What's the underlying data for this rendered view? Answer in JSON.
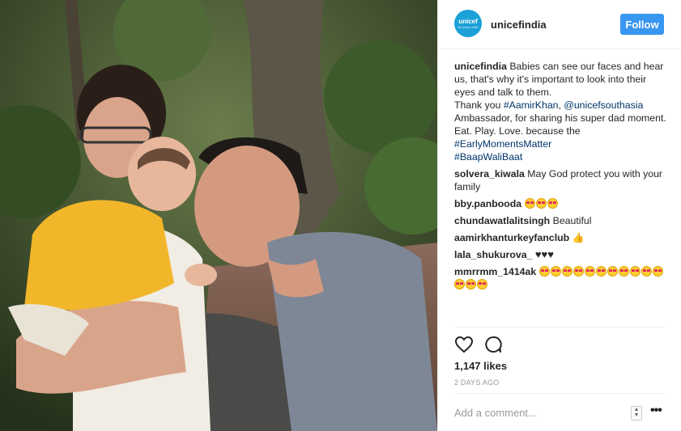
{
  "post": {
    "account": "unicefindia",
    "avatar_label": "unicef",
    "avatar_sub": "for every child",
    "follow_label": "Follow"
  },
  "caption": {
    "user": "unicefindia",
    "text1": "Babies can see our faces and hear us, that's why it's important to look into their eyes and talk to them.",
    "text2": "Thank you",
    "tag1": "#AamirKhan",
    "comma": ",",
    "tag2": "@unicefsouthasia",
    "text3": "Ambassador, for sharing his super dad moment. Eat. Play. Love. because the",
    "tag3": "#EarlyMomentsMatter",
    "tag4": "#BaapWaliBaat"
  },
  "comments": [
    {
      "user": "solvera_kiwala",
      "text": "May God protect you with your family"
    },
    {
      "user": "bby.panbooda",
      "emoji": "heart-eyes-x3"
    },
    {
      "user": "chundawatlalitsingh",
      "text": "Beautiful"
    },
    {
      "user": "aamirkhanturkeyfanclub",
      "emoji": "thumbs-up"
    },
    {
      "user": "lala_shukurova_",
      "text": "♥♥♥"
    },
    {
      "user": "mmrrmm_1414ak",
      "emoji": "heart-eyes-x14"
    }
  ],
  "likes": "1,147 likes",
  "time_ago": "2 DAYS AGO",
  "add_comment_placeholder": "Add a comment...",
  "icons": {
    "like": "heart-outline-icon",
    "comment": "speech-bubble-icon",
    "sort": "up-down-arrows-icon",
    "more": "ellipsis-icon"
  },
  "colors": {
    "follow": "#3897f0",
    "hashtag": "#003569",
    "unicef_blue": "#1ca0d8",
    "muted": "#999999"
  }
}
